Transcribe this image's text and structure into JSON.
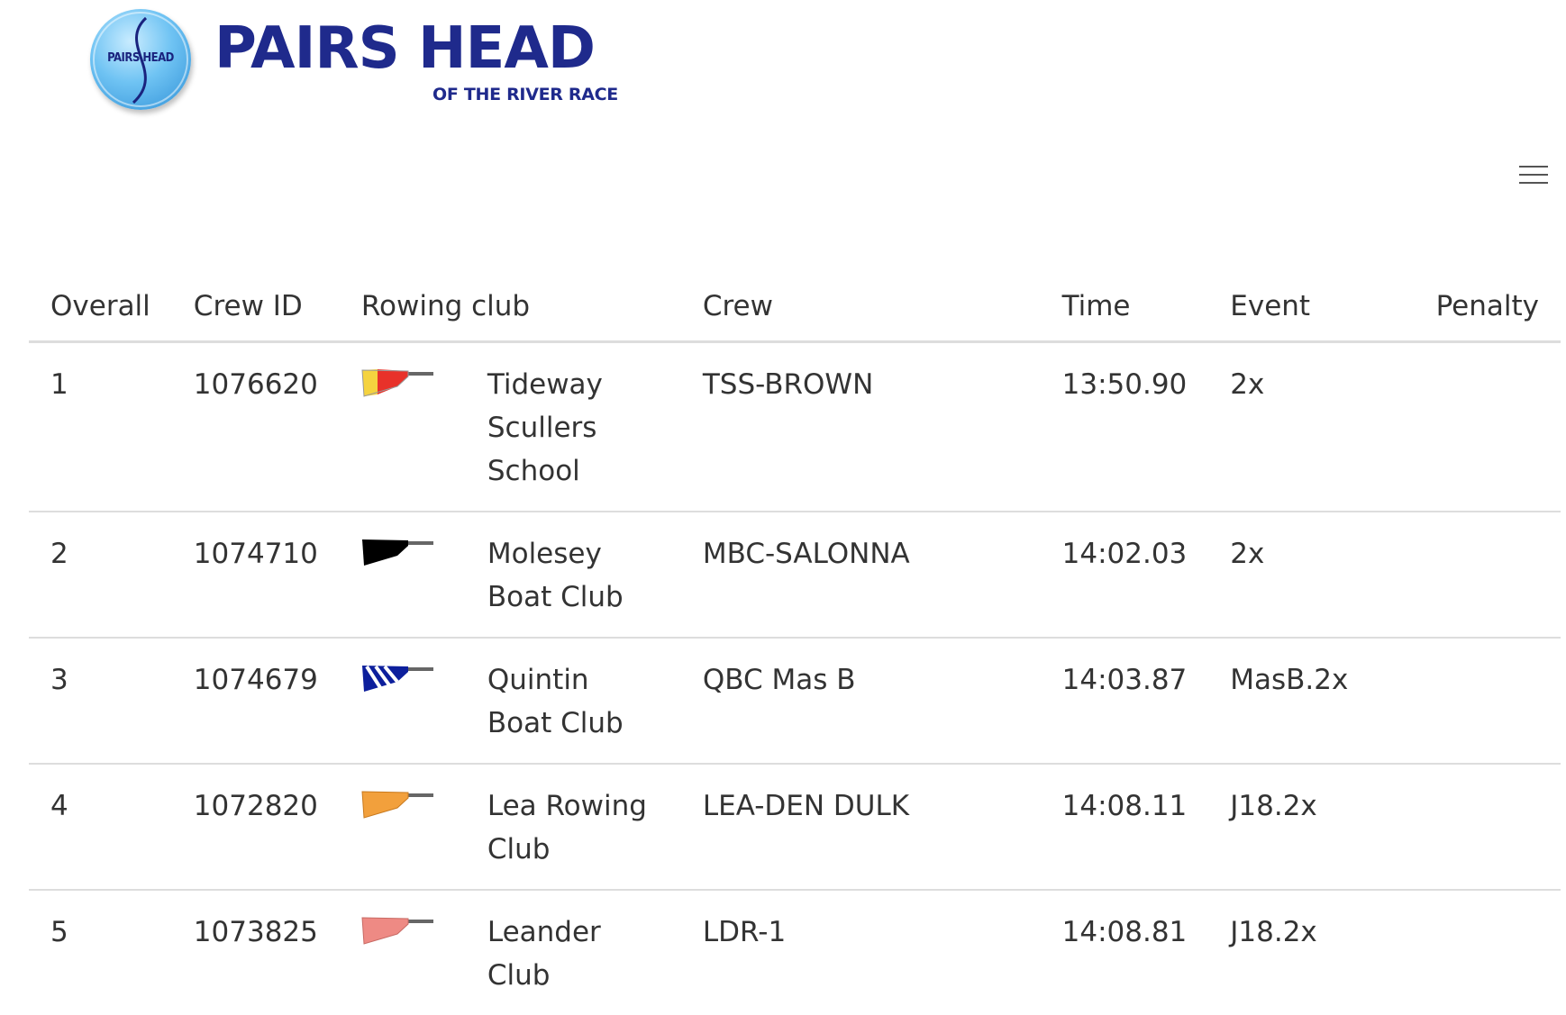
{
  "header": {
    "logo_badge_text": "PAIRS HEAD",
    "logo_title": "PAIRS HEAD",
    "logo_subtitle": "OF THE RIVER RACE"
  },
  "menu": {
    "icon": "hamburger-menu-icon"
  },
  "table": {
    "columns": {
      "overall": "Overall",
      "crew_id": "Crew ID",
      "rowing_club": "Rowing club",
      "crew": "Crew",
      "time": "Time",
      "event": "Event",
      "penalty": "Penalty"
    },
    "rows": [
      {
        "overall": "1",
        "crew_id": "1076620",
        "club_name": "Tideway Scullers School",
        "crew": "TSS-BROWN",
        "time": "13:50.90",
        "event": "2x",
        "penalty": "",
        "blade": {
          "icon": "tideway-scullers-blade-icon",
          "colors": [
            "#f5d33f",
            "#e8322a"
          ]
        }
      },
      {
        "overall": "2",
        "crew_id": "1074710",
        "club_name": "Molesey Boat Club",
        "crew": "MBC-SALONNA",
        "time": "14:02.03",
        "event": "2x",
        "penalty": "",
        "blade": {
          "icon": "molesey-blade-icon",
          "colors": [
            "#000000"
          ]
        }
      },
      {
        "overall": "3",
        "crew_id": "1074679",
        "club_name": "Quintin Boat Club",
        "crew": "QBC Mas B",
        "time": "14:03.87",
        "event": "MasB.2x",
        "penalty": "",
        "blade": {
          "icon": "quintin-blade-icon",
          "colors": [
            "#0d1f9c",
            "#ffffff"
          ]
        }
      },
      {
        "overall": "4",
        "crew_id": "1072820",
        "club_name": "Lea Rowing Club",
        "crew": "LEA-DEN DULK",
        "time": "14:08.11",
        "event": "J18.2x",
        "penalty": "",
        "blade": {
          "icon": "lea-blade-icon",
          "colors": [
            "#f2a03c"
          ]
        }
      },
      {
        "overall": "5",
        "crew_id": "1073825",
        "club_name": "Leander Club",
        "crew": "LDR-1",
        "time": "14:08.81",
        "event": "J18.2x",
        "penalty": "",
        "blade": {
          "icon": "leander-blade-icon",
          "colors": [
            "#ee8a84"
          ]
        }
      }
    ]
  }
}
